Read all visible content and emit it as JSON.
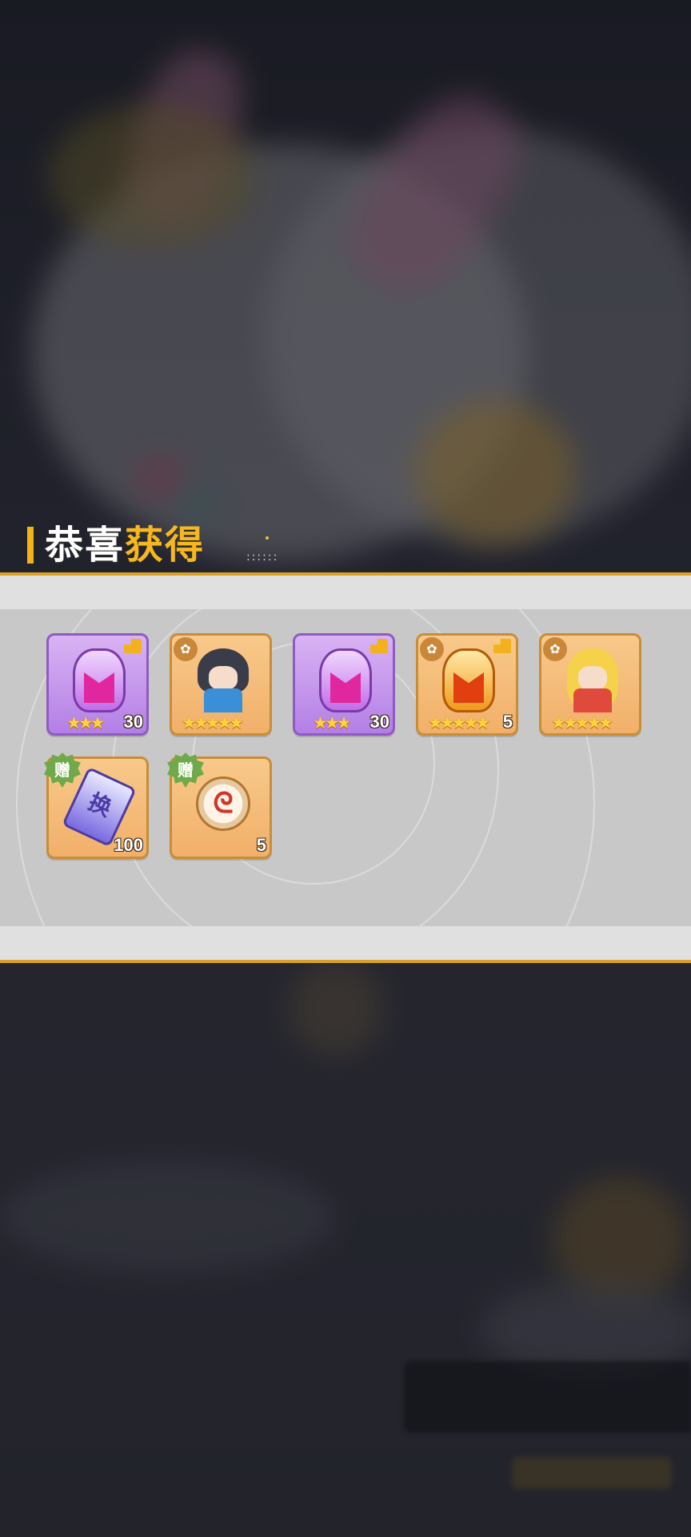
{
  "title": {
    "part1": "恭喜",
    "part2": "获得"
  },
  "rewards": [
    {
      "name": "purple-helmet",
      "rarity": "purple",
      "stars": "★★★",
      "quantity": "30",
      "badge": "flag"
    },
    {
      "name": "black-hair-hero",
      "rarity": "orange",
      "stars": "★★★★★",
      "quantity": "",
      "badge": "lotus"
    },
    {
      "name": "purple-helmet",
      "rarity": "purple",
      "stars": "★★★",
      "quantity": "30",
      "badge": "flag"
    },
    {
      "name": "gold-helmet",
      "rarity": "orange",
      "stars": "★★★★★",
      "quantity": "5",
      "badge": "flag+lotus"
    },
    {
      "name": "blonde-hero",
      "rarity": "orange",
      "stars": "★★★★★",
      "quantity": "",
      "badge": "lotus"
    },
    {
      "name": "exchange-ticket",
      "rarity": "orange",
      "stars": "",
      "quantity": "100",
      "badge": "gift",
      "gift_label": "赠",
      "ticket_char": "换"
    },
    {
      "name": "dragon-coin",
      "rarity": "orange",
      "stars": "",
      "quantity": "5",
      "badge": "gift",
      "gift_label": "赠"
    }
  ],
  "colors": {
    "accent": "#f7b81f",
    "panel": "#c8c8c9",
    "gold_line": "#d9a126",
    "gift_green": "#6fa94a"
  },
  "icons": {
    "lotus": "lotus-icon",
    "flag": "flag-icon",
    "gift": "gift-badge-icon"
  },
  "lotus_glyph": "✿"
}
